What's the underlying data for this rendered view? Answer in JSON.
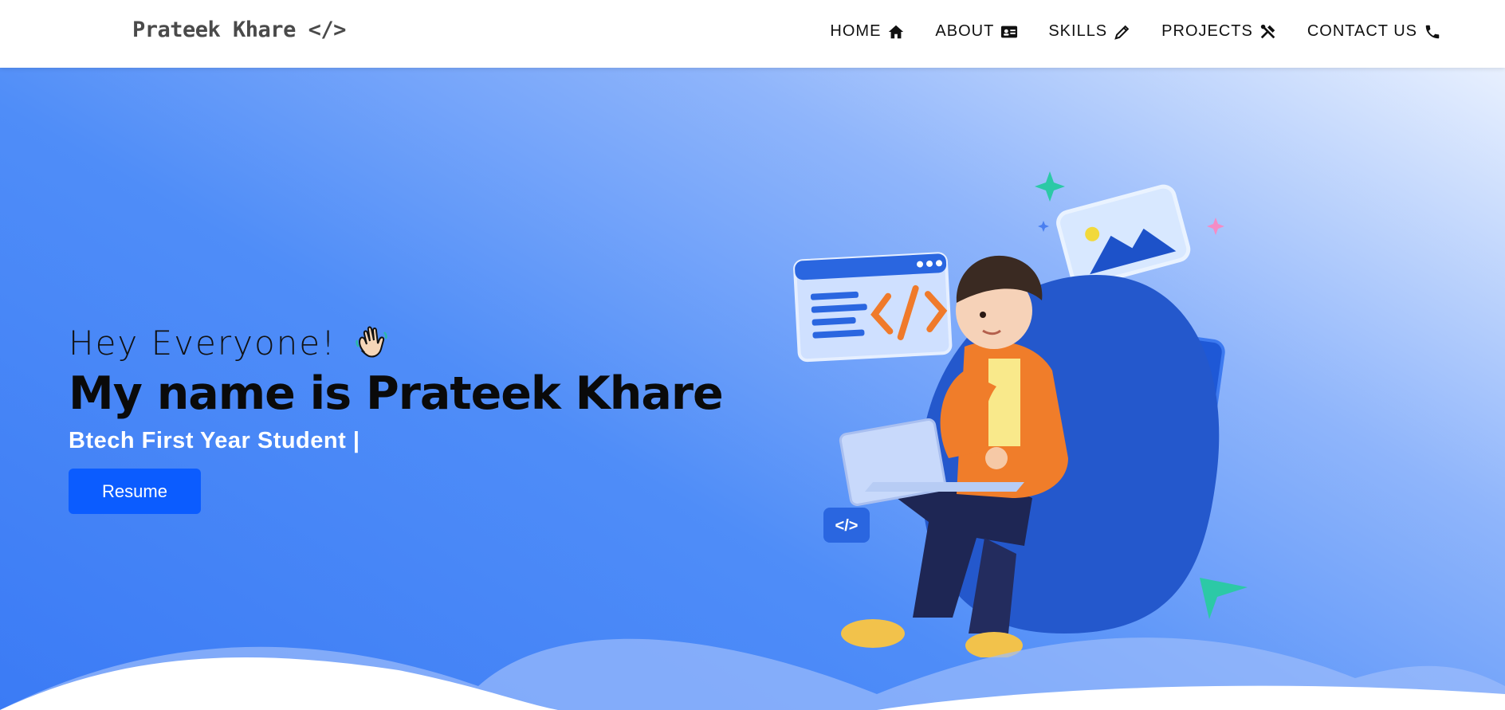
{
  "brand": "Prateek Khare </>",
  "nav": [
    {
      "label": "HOME",
      "icon": "home-icon"
    },
    {
      "label": "ABOUT",
      "icon": "id-card-icon"
    },
    {
      "label": "SKILLS",
      "icon": "pencil-icon"
    },
    {
      "label": "PROJECTS",
      "icon": "tools-icon"
    },
    {
      "label": "CONTACT US",
      "icon": "phone-icon"
    }
  ],
  "hero": {
    "greeting": "Hey Everyone!",
    "title": "My name is Prateek Khare",
    "subtitle": "Btech First Year Student |",
    "resume_label": "Resume"
  },
  "colors": {
    "accent": "#0b5cff",
    "hero_start": "#3b7bf5",
    "hero_end": "#e8f0fe"
  }
}
